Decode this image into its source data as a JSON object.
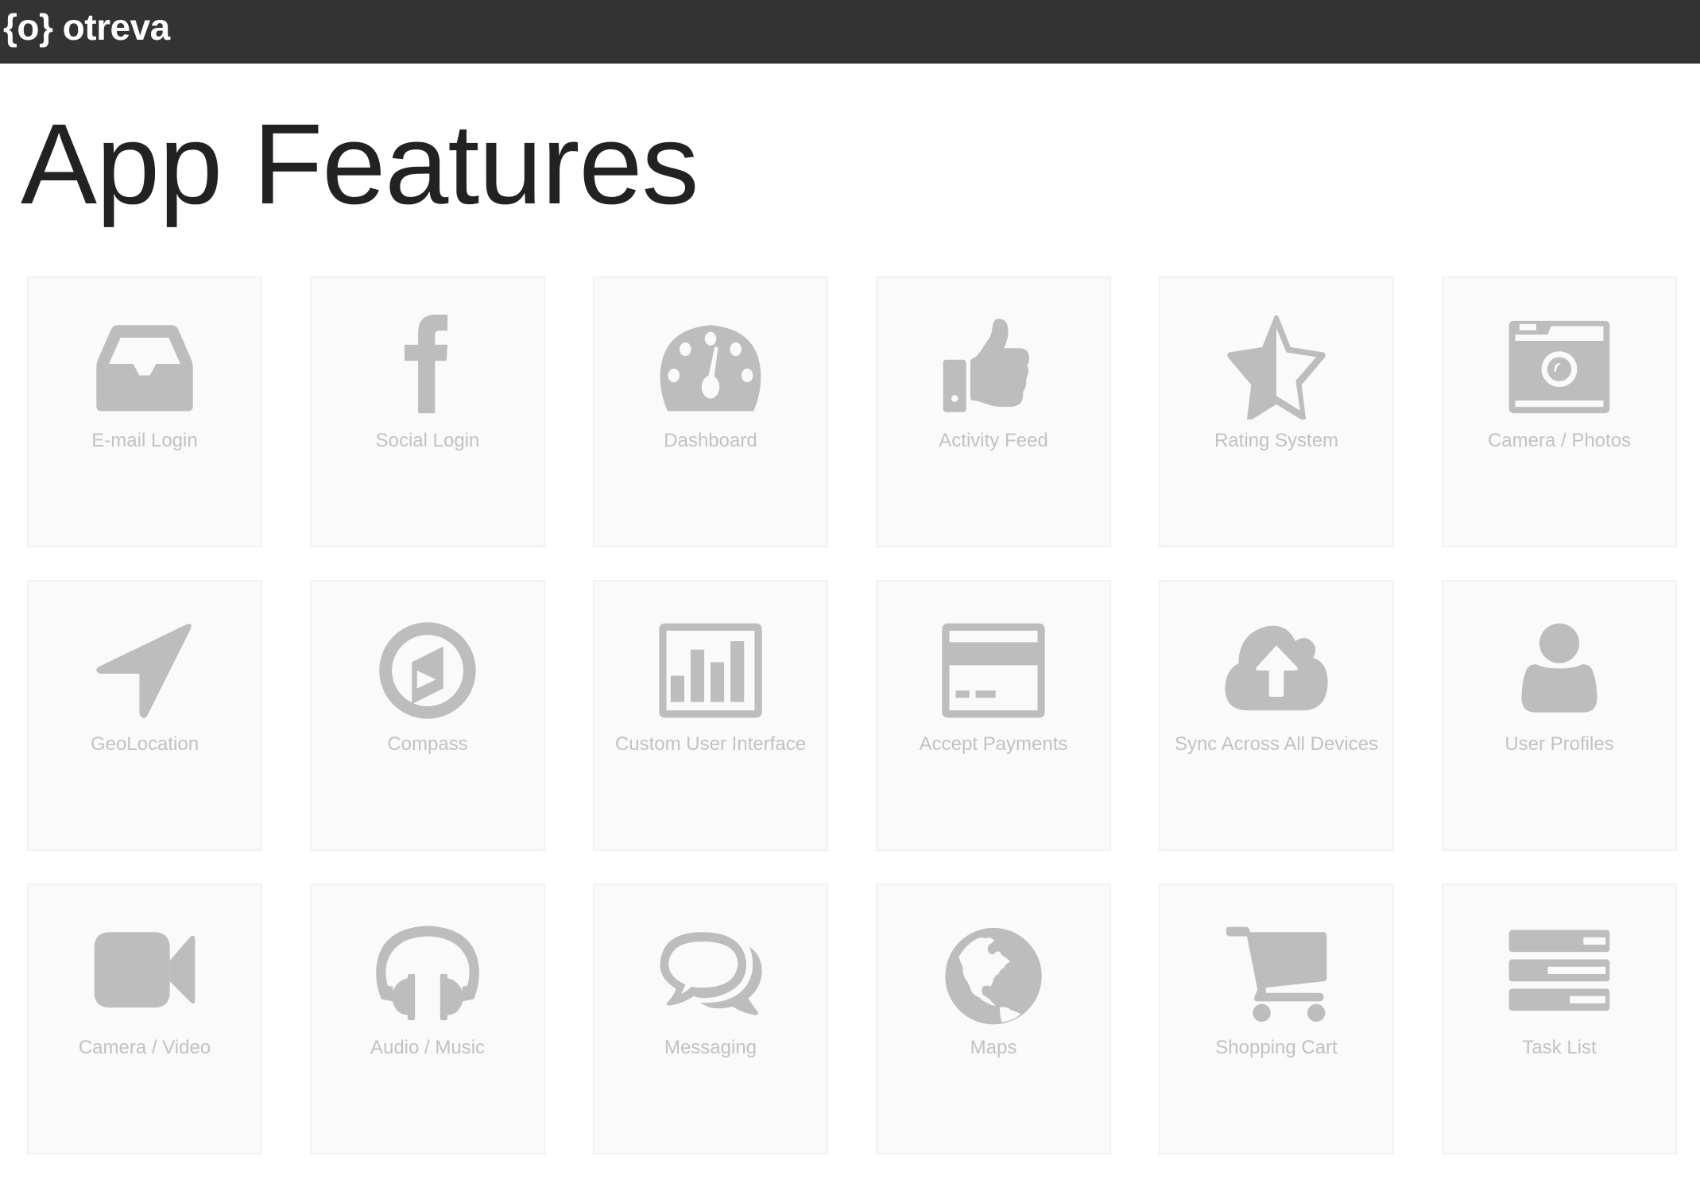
{
  "header": {
    "logo_text": "{o} otreva",
    "background_color": "#333333"
  },
  "page": {
    "title": "App Features"
  },
  "colors": {
    "icon": "#bdbdbd",
    "label": "#c2c2c2",
    "card_background": "#fafafa",
    "card_border": "#f1f1f1",
    "title": "#222222"
  },
  "features": [
    {
      "label": "E-mail Login",
      "icon": "inbox-icon"
    },
    {
      "label": "Social Login",
      "icon": "facebook-icon"
    },
    {
      "label": "Dashboard",
      "icon": "dashboard-gauge-icon"
    },
    {
      "label": "Activity Feed",
      "icon": "thumbs-up-icon"
    },
    {
      "label": "Rating System",
      "icon": "half-star-icon"
    },
    {
      "label": "Camera / Photos",
      "icon": "photo-camera-icon"
    },
    {
      "label": "GeoLocation",
      "icon": "location-arrow-icon"
    },
    {
      "label": "Compass",
      "icon": "compass-icon"
    },
    {
      "label": "Custom User Interface",
      "icon": "bar-chart-icon"
    },
    {
      "label": "Accept Payments",
      "icon": "credit-card-icon"
    },
    {
      "label": "Sync Across All Devices",
      "icon": "cloud-upload-icon"
    },
    {
      "label": "User Profiles",
      "icon": "user-icon"
    },
    {
      "label": "Camera / Video",
      "icon": "video-camera-icon"
    },
    {
      "label": "Audio / Music",
      "icon": "headphones-icon"
    },
    {
      "label": "Messaging",
      "icon": "chat-bubbles-icon"
    },
    {
      "label": "Maps",
      "icon": "globe-icon"
    },
    {
      "label": "Shopping Cart",
      "icon": "shopping-cart-icon"
    },
    {
      "label": "Task List",
      "icon": "task-list-icon"
    }
  ]
}
